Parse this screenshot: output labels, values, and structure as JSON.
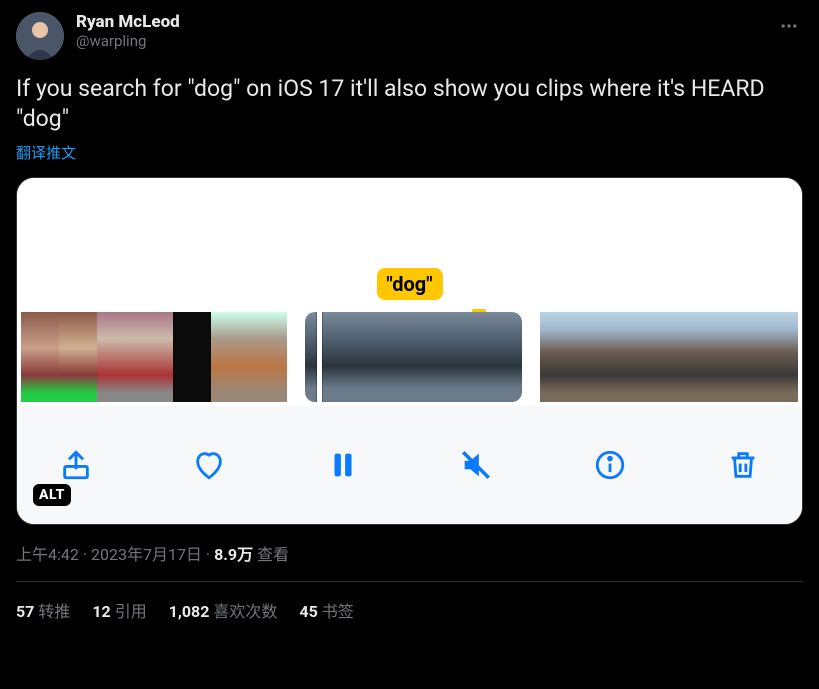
{
  "author": {
    "display_name": "Ryan McLeod",
    "handle": "@warpling"
  },
  "tweet_text": "If you search for \"dog\" on iOS 17 it'll also show you clips where it's HEARD \"dog\"",
  "translate_label": "翻译推文",
  "media": {
    "tooltip": "\"dog\"",
    "alt_badge": "ALT"
  },
  "meta": {
    "time": "上午4:42",
    "date": "2023年7月17日",
    "views_value": "8.9万",
    "views_label": "查看",
    "separator": " · "
  },
  "stats": {
    "retweets_value": "57",
    "retweets_label": "转推",
    "quotes_value": "12",
    "quotes_label": "引用",
    "likes_value": "1,082",
    "likes_label": "喜欢次数",
    "bookmarks_value": "45",
    "bookmarks_label": "书签"
  }
}
